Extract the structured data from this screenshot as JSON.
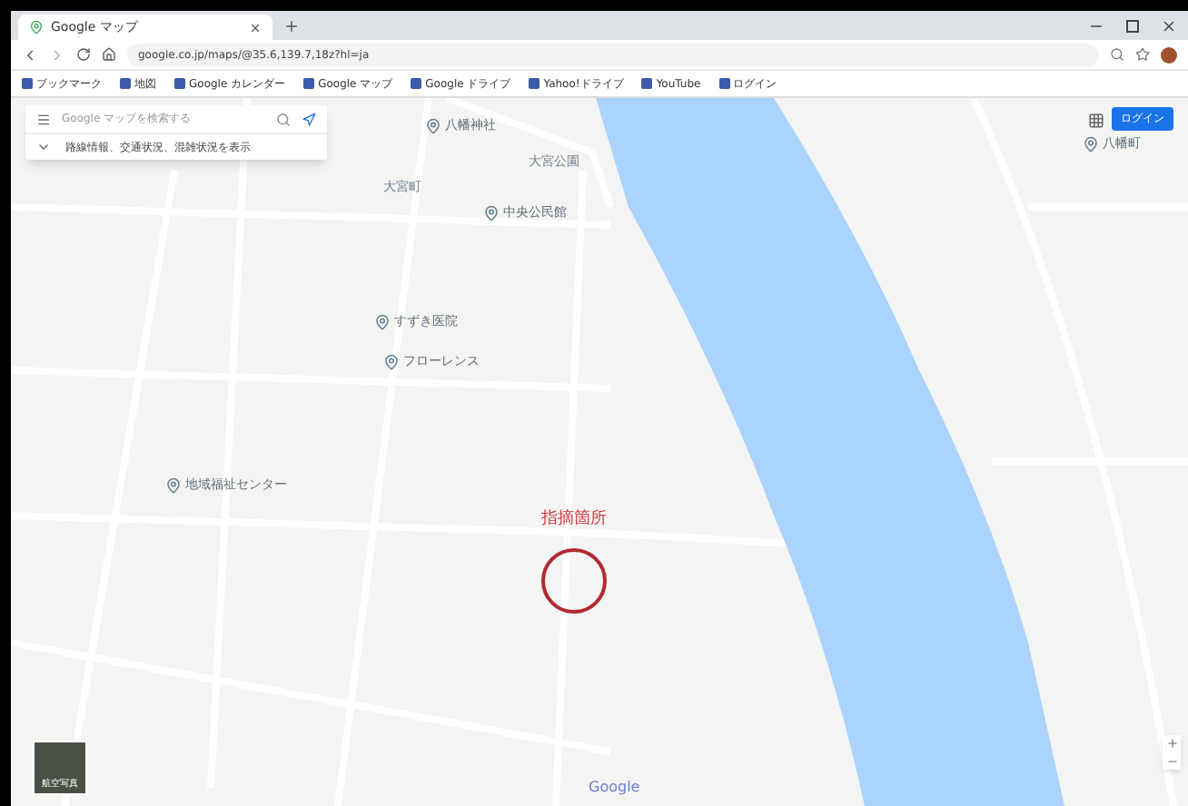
{
  "tab": {
    "title": "Google マップ",
    "selected": true
  },
  "address_bar": {
    "url": "google.co.jp/maps/@35.6,139.7,18z?hl=ja"
  },
  "bookmarks": [
    "ブックマーク",
    "地図",
    "Google カレンダー",
    "Google マップ",
    "Google ドライブ",
    "Yahoo!ドライブ",
    "YouTube",
    "ログイン"
  ],
  "search": {
    "placeholder": "Google マップを検索する"
  },
  "layers_hint": "路線情報、交通状況、混雑状況を表示",
  "login_button": "ログイン",
  "map_labels": [
    {
      "text": "八幡神社",
      "kind": "poi"
    },
    {
      "text": "大宮町",
      "kind": "road"
    },
    {
      "text": "大宮公園",
      "kind": "road"
    },
    {
      "text": "中央公民館",
      "kind": "poi"
    },
    {
      "text": "八幡町",
      "kind": "poi"
    },
    {
      "text": "すずき医院",
      "kind": "poi"
    },
    {
      "text": "フローレンス",
      "kind": "poi"
    },
    {
      "text": "地域福祉センター",
      "kind": "poi"
    },
    {
      "text": "指摘箇所",
      "kind": "marker"
    }
  ],
  "satellite_toggle": "航空写真",
  "google_logo": "Google"
}
